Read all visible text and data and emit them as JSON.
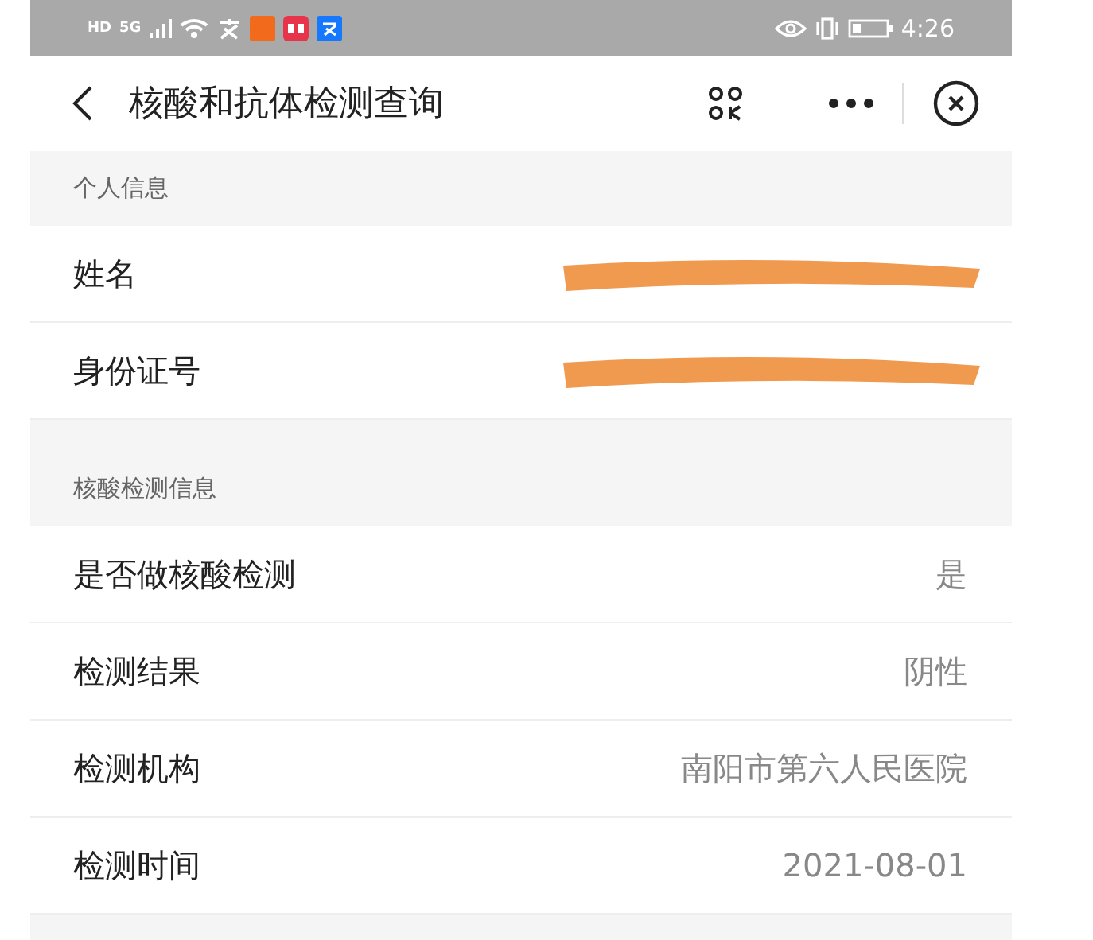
{
  "status_bar": {
    "badges": [
      "HD",
      "5G"
    ],
    "time": "4:26"
  },
  "header": {
    "title": "核酸和抗体检测查询"
  },
  "sections": [
    {
      "title": "个人信息",
      "rows": [
        {
          "label": "姓名",
          "kind": "redacted"
        },
        {
          "label": "身份证号",
          "kind": "redacted"
        }
      ]
    },
    {
      "title": "核酸检测信息",
      "rows": [
        {
          "label": "是否做核酸检测",
          "kind": "value",
          "value": "是"
        },
        {
          "label": "检测结果",
          "kind": "value",
          "value": "阴性"
        },
        {
          "label": "检测机构",
          "kind": "value",
          "value": "南阳市第六人民医院"
        },
        {
          "label": "检测时间",
          "kind": "value",
          "value": "2021-08-01"
        }
      ]
    }
  ]
}
